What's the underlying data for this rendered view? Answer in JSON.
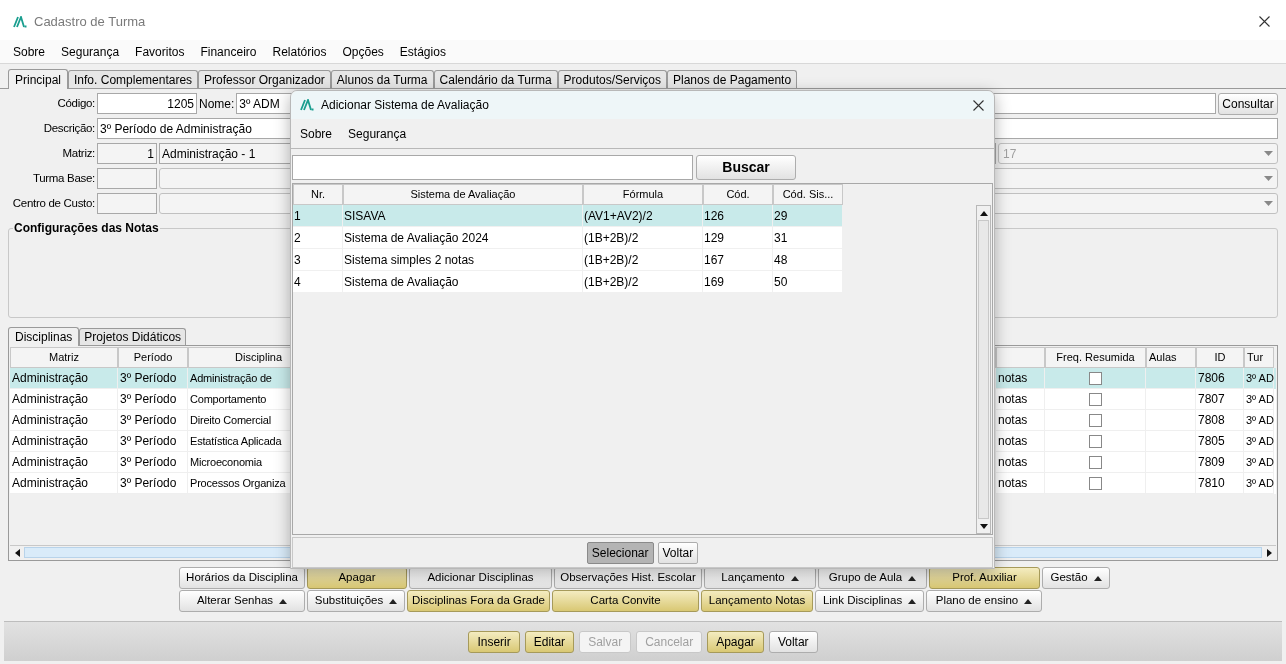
{
  "window": {
    "title": "Cadastro de Turma"
  },
  "menu": [
    "Sobre",
    "Segurança",
    "Favoritos",
    "Financeiro",
    "Relatórios",
    "Opções",
    "Estágios"
  ],
  "tabs": [
    {
      "label": "Principal",
      "selected": true
    },
    {
      "label": "Info. Complementares",
      "selected": false
    },
    {
      "label": "Professor Organizador",
      "selected": false
    },
    {
      "label": "Alunos da Turma",
      "selected": false
    },
    {
      "label": "Calendário da Turma",
      "selected": false
    },
    {
      "label": "Produtos/Serviços",
      "selected": false
    },
    {
      "label": "Planos de Pagamento",
      "selected": false
    }
  ],
  "form": {
    "codigo": {
      "label": "Código:",
      "value": "1205"
    },
    "nome": {
      "label": "Nome:",
      "value": "3º ADM"
    },
    "consultar_button": "Consultar",
    "descricao": {
      "label": "Descrição:",
      "value": "3º Período de Administração"
    },
    "matriz": {
      "label": "Matriz:",
      "code": "1",
      "name": "Administração - 1",
      "column_3": "17"
    },
    "turma_base": {
      "label": "Turma Base:"
    },
    "centro_de_custo": {
      "label": "Centro de Custo:"
    }
  },
  "group": {
    "title": "Configurações das Notas"
  },
  "sub_tabs": [
    {
      "label": "Disciplinas",
      "selected": true
    },
    {
      "label": "Projetos Didáticos",
      "selected": false
    }
  ],
  "table": {
    "columns": {
      "matriz": "Matriz",
      "periodo": "Período",
      "disciplina": "Disciplina",
      "freq_resumida": "Freq. Resumida",
      "aulas": "Aulas",
      "id": "ID",
      "column_8": "Tur"
    },
    "rows": [
      {
        "matriz": "Administração",
        "periodo": "3º Período",
        "disciplina": "Administração de",
        "column_4": "notas",
        "freq_resumida": false,
        "id": "7806",
        "column_8": "3º AD",
        "selected": true
      },
      {
        "matriz": "Administração",
        "periodo": "3º Período",
        "disciplina": "Comportamento",
        "column_4": "notas",
        "freq_resumida": false,
        "id": "7807",
        "column_8": "3º AD",
        "selected": false
      },
      {
        "matriz": "Administração",
        "periodo": "3º Período",
        "disciplina": "Direito Comercial",
        "column_4": "notas",
        "freq_resumida": false,
        "id": "7808",
        "column_8": "3º AD",
        "selected": false
      },
      {
        "matriz": "Administração",
        "periodo": "3º Período",
        "disciplina": "Estatística Aplicada",
        "column_4": "notas",
        "freq_resumida": false,
        "id": "7805",
        "column_8": "3º AD",
        "selected": false
      },
      {
        "matriz": "Administração",
        "periodo": "3º Período",
        "disciplina": "Microeconomia",
        "column_4": "notas",
        "freq_resumida": false,
        "id": "7809",
        "column_8": "3º AD",
        "selected": false
      },
      {
        "matriz": "Administração",
        "periodo": "3º Período",
        "disciplina": "Processos Organiza",
        "column_4": "notas",
        "freq_resumida": false,
        "id": "7810",
        "column_8": "3º AD",
        "selected": false
      }
    ]
  },
  "action_buttons": [
    [
      {
        "label": "Horários da Disciplina",
        "kind": "plain",
        "menu": false
      },
      {
        "label": "Apagar",
        "kind": "accent",
        "menu": false
      },
      {
        "label": "Adicionar Disciplinas",
        "kind": "plain",
        "menu": false
      },
      {
        "label": "Observações Hist. Escolar",
        "kind": "plain",
        "menu": false
      },
      {
        "label": "Lançamento",
        "kind": "plain",
        "menu": true
      },
      {
        "label": "Grupo de Aula",
        "kind": "plain",
        "menu": true
      },
      {
        "label": "Prof. Auxiliar",
        "kind": "accent",
        "menu": false
      },
      {
        "label": "Gestão",
        "kind": "plain",
        "menu": true
      }
    ],
    [
      {
        "label": "Alterar Senhas",
        "kind": "plain",
        "menu": true
      },
      {
        "label": "Substituições",
        "kind": "plain",
        "menu": true
      },
      {
        "label": "Disciplinas Fora da Grade",
        "kind": "accent",
        "menu": false
      },
      {
        "label": "Carta Convite",
        "kind": "accent",
        "menu": false
      },
      {
        "label": "Lançamento Notas",
        "kind": "accent",
        "menu": false
      },
      {
        "label": "Link Disciplinas",
        "kind": "plain",
        "menu": true
      },
      {
        "label": "Plano de ensino",
        "kind": "plain",
        "menu": true
      }
    ]
  ],
  "toolbar": [
    {
      "label": "Inserir",
      "kind": "accent",
      "disabled": false
    },
    {
      "label": "Editar",
      "kind": "accent",
      "disabled": false
    },
    {
      "label": "Salvar",
      "kind": "plain",
      "disabled": true
    },
    {
      "label": "Cancelar",
      "kind": "plain",
      "disabled": true
    },
    {
      "label": "Apagar",
      "kind": "accent",
      "disabled": false
    },
    {
      "label": "Voltar",
      "kind": "plain",
      "disabled": false
    }
  ],
  "dialog": {
    "title": "Adicionar Sistema de Avaliação",
    "menu": [
      "Sobre",
      "Segurança"
    ],
    "search_button": "Buscar",
    "table": {
      "columns": [
        "Nr.",
        "Sistema de Avaliação",
        "Fórmula",
        "Cód.",
        "Cód. Sis..."
      ],
      "rows": [
        {
          "cells": [
            "1",
            "SISAVA",
            "(AV1+AV2)/2",
            "126",
            "29"
          ],
          "selected": true
        },
        {
          "cells": [
            "2",
            "Sistema de Avaliação 2024",
            "(1B+2B)/2",
            "129",
            "31"
          ],
          "selected": false
        },
        {
          "cells": [
            "3",
            "Sistema simples 2 notas",
            "(1B+2B)/2",
            "167",
            "48"
          ],
          "selected": false
        },
        {
          "cells": [
            "4",
            "Sistema de Avaliação",
            "(1B+2B)/2",
            "169",
            "50"
          ],
          "selected": false
        }
      ]
    },
    "buttons": [
      {
        "label": "Selecionar",
        "pressed": true
      },
      {
        "label": "Voltar",
        "pressed": false
      }
    ]
  }
}
